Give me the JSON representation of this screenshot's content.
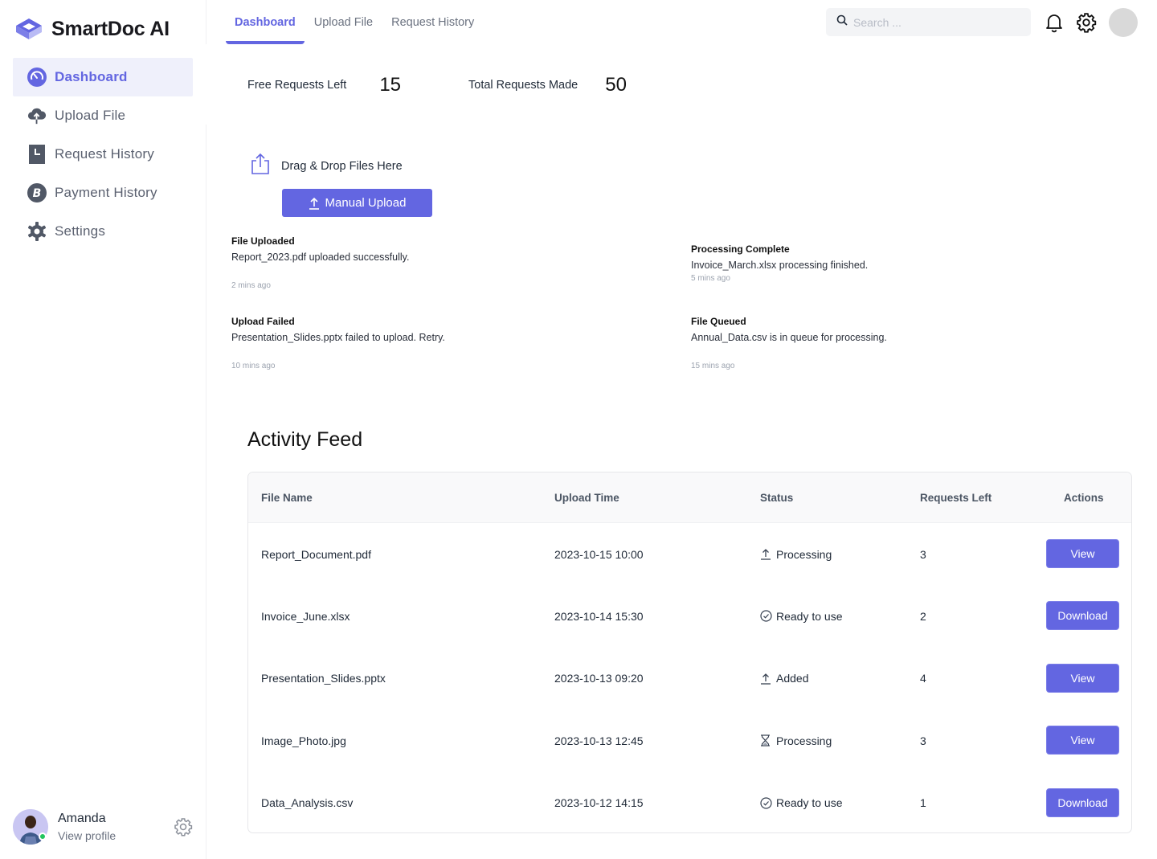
{
  "app": {
    "name": "SmartDoc AI",
    "brand_color": "#6366e1"
  },
  "sidebar": {
    "items": [
      {
        "label": "Dashboard",
        "icon": "dashboard-gauge-icon",
        "active": true
      },
      {
        "label": "Upload File",
        "icon": "cloud-upload-icon",
        "active": false
      },
      {
        "label": "Request History",
        "icon": "history-icon",
        "active": false
      },
      {
        "label": "Payment History",
        "icon": "bitcoin-icon",
        "active": false
      },
      {
        "label": "Settings",
        "icon": "gear-icon",
        "active": false
      }
    ],
    "profile": {
      "name": "Amanda",
      "link": "View profile",
      "status": "online"
    }
  },
  "topnav": {
    "tabs": [
      {
        "label": "Dashboard",
        "active": true
      },
      {
        "label": "Upload File",
        "active": false
      },
      {
        "label": "Request History",
        "active": false
      }
    ],
    "search_placeholder": "Search ...",
    "search_value": ""
  },
  "stats": {
    "free_label": "Free Requests Left",
    "free_value": "15",
    "total_label": "Total Requests Made",
    "total_value": "50"
  },
  "upload": {
    "dropzone_label": "Drag & Drop Files Here",
    "button_label": "Manual Upload"
  },
  "notifications": [
    {
      "title": "File Uploaded",
      "body": "Report_2023.pdf uploaded successfully.",
      "time": "2 mins ago"
    },
    {
      "title": "Processing Complete",
      "body": "Invoice_March.xlsx processing finished.",
      "time": "5 mins ago"
    },
    {
      "title": "Upload Failed",
      "body": "Presentation_Slides.pptx failed to upload. Retry.",
      "time": "10 mins ago"
    },
    {
      "title": "File Queued",
      "body": "Annual_Data.csv is in queue for processing.",
      "time": "15 mins ago"
    }
  ],
  "activity_feed": {
    "title": "Activity Feed",
    "columns": [
      "File Name",
      "Upload Time",
      "Status",
      "Requests Left",
      "Actions"
    ],
    "rows": [
      {
        "file": "Report_Document.pdf",
        "time": "2023-10-15 10:00",
        "status": "Processing",
        "status_icon": "upload-arrow-icon",
        "requests_left": "3",
        "action": "View"
      },
      {
        "file": "Invoice_June.xlsx",
        "time": "2023-10-14 15:30",
        "status": "Ready to use",
        "status_icon": "check-circle-icon",
        "requests_left": "2",
        "action": "Download"
      },
      {
        "file": "Presentation_Slides.pptx",
        "time": "2023-10-13 09:20",
        "status": "Added",
        "status_icon": "upload-arrow-icon",
        "requests_left": "4",
        "action": "View"
      },
      {
        "file": "Image_Photo.jpg",
        "time": "2023-10-13 12:45",
        "status": "Processing",
        "status_icon": "hourglass-icon",
        "requests_left": "3",
        "action": "View"
      },
      {
        "file": "Data_Analysis.csv",
        "time": "2023-10-12 14:15",
        "status": "Ready to use",
        "status_icon": "check-circle-icon",
        "requests_left": "1",
        "action": "Download"
      }
    ]
  }
}
